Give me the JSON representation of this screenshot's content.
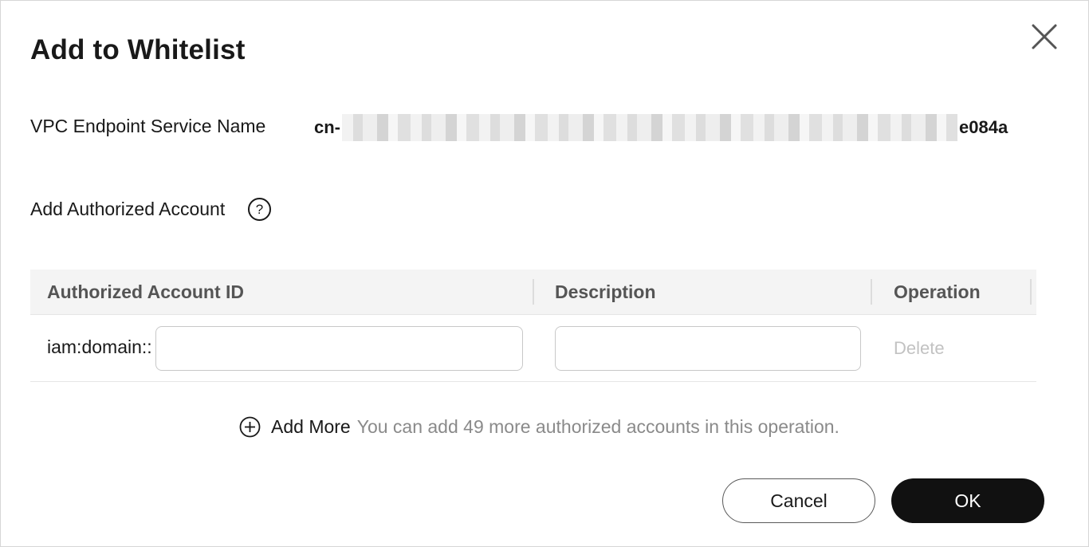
{
  "dialog": {
    "title": "Add to Whitelist"
  },
  "service": {
    "label": "VPC Endpoint Service Name",
    "value_prefix": "cn-",
    "value_suffix": "e084a"
  },
  "authorized": {
    "label": "Add Authorized Account",
    "help_icon": "question-circle-icon",
    "help_glyph": "?"
  },
  "table": {
    "columns": [
      "Authorized Account ID",
      "Description",
      "Operation"
    ],
    "rows": [
      {
        "account_prefix": "iam:domain::",
        "account_value": "",
        "description_value": "",
        "operation": "Delete"
      }
    ]
  },
  "add_more": {
    "icon": "plus-circle-icon",
    "label": "Add More",
    "hint": "You can add 49 more authorized accounts in this operation."
  },
  "footer": {
    "cancel_label": "Cancel",
    "ok_label": "OK"
  },
  "colors": {
    "primary_button": "#111111",
    "muted_text": "#8a8a8a",
    "disabled_text": "#c2c2c2",
    "header_bg": "#f4f4f4"
  }
}
